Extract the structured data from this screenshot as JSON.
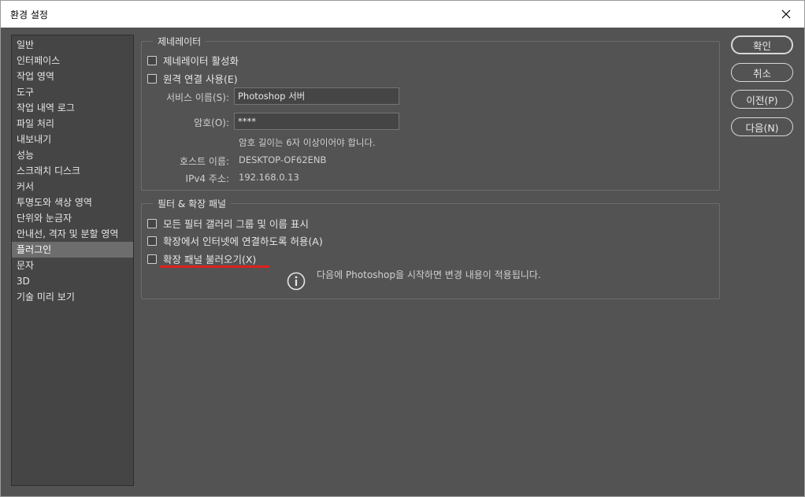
{
  "window": {
    "title": "환경 설정"
  },
  "sidebar": {
    "items": [
      {
        "label": "일반"
      },
      {
        "label": "인터페이스"
      },
      {
        "label": "작업 영역"
      },
      {
        "label": "도구"
      },
      {
        "label": "작업 내역 로그"
      },
      {
        "label": "파일 처리"
      },
      {
        "label": "내보내기"
      },
      {
        "label": "성능"
      },
      {
        "label": "스크래치 디스크"
      },
      {
        "label": "커서"
      },
      {
        "label": "투명도와 색상 영역"
      },
      {
        "label": "단위와 눈금자"
      },
      {
        "label": "안내선, 격자 및 분할 영역"
      },
      {
        "label": "플러그인",
        "selected": true
      },
      {
        "label": "문자"
      },
      {
        "label": "3D"
      },
      {
        "label": "기술 미리 보기"
      }
    ]
  },
  "generator": {
    "legend": "제네레이터",
    "enable_label": "제네레이터 활성화",
    "remote_label": "원격 연결 사용(E)",
    "service_name_label": "서비스 이름(S):",
    "service_name_value": "Photoshop 서버",
    "password_label": "암호(O):",
    "password_value": "****",
    "password_hint": "암호 길이는 6자 이상이어야 합니다.",
    "host_label": "호스트 이름:",
    "host_value": "DESKTOP-OF62ENB",
    "ipv4_label": "IPv4 주소:",
    "ipv4_value": "192.168.0.13"
  },
  "filters": {
    "legend": "필터 & 확장 패널",
    "show_all_label": "모든 필터 갤러리 그룹 및 이름 표시",
    "allow_internet_label": "확장에서 인터넷에 연결하도록 허용(A)",
    "load_panels_label": "확장 패널 불러오기(X)",
    "restart_note": "다음에 Photoshop을 시작하면 변경 내용이 적용됩니다."
  },
  "buttons": {
    "ok": "확인",
    "cancel": "취소",
    "prev": "이전(P)",
    "next": "다음(N)"
  },
  "colors": {
    "dialog_bg": "#535353",
    "sidebar_bg": "#454545",
    "selected_bg": "#6d6d6d",
    "highlight_underline": "#e0201b"
  }
}
